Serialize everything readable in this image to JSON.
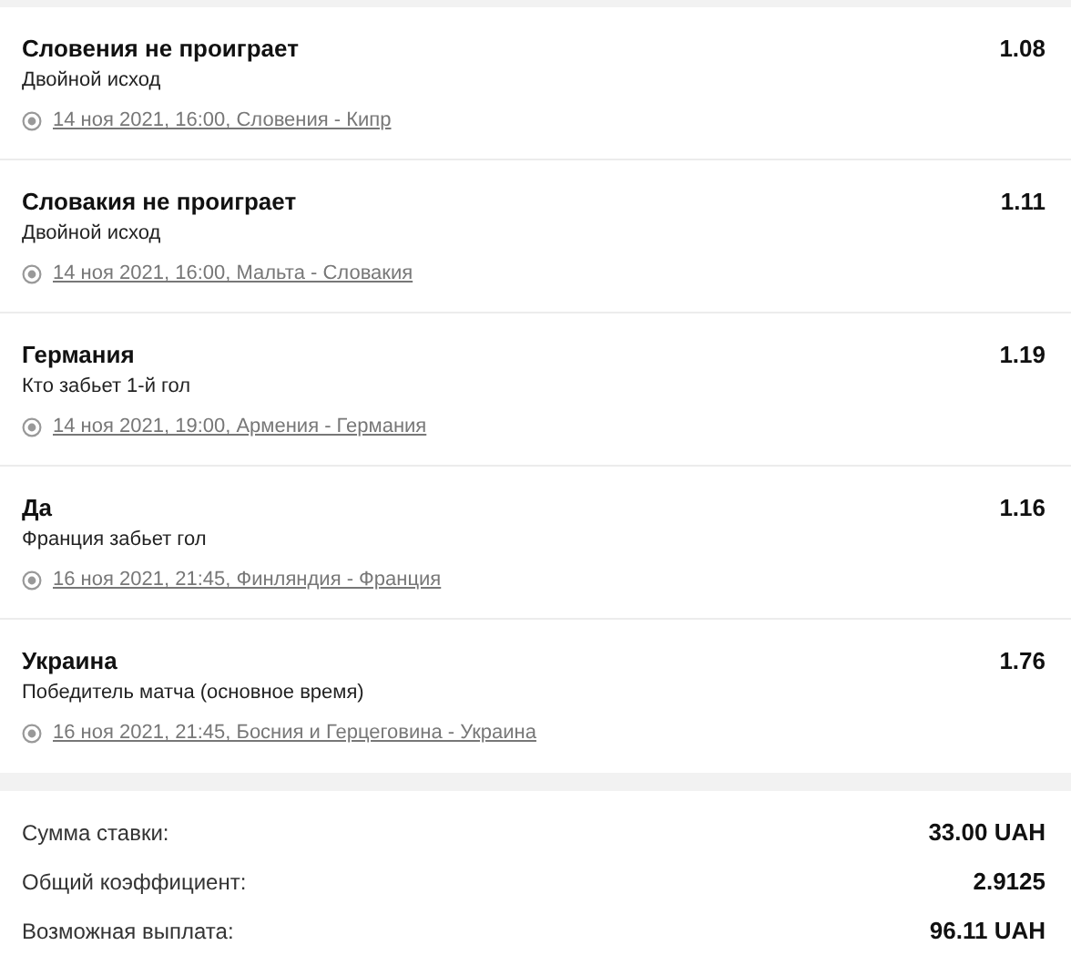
{
  "bets": [
    {
      "title": "Словения не проиграет",
      "market": "Двойной исход",
      "event": "14 ноя 2021, 16:00, Словения - Кипр",
      "odds": "1.08"
    },
    {
      "title": "Словакия не проиграет",
      "market": "Двойной исход",
      "event": "14 ноя 2021, 16:00, Мальта - Словакия",
      "odds": "1.11"
    },
    {
      "title": "Германия",
      "market": "Кто забьет 1-й гол",
      "event": "14 ноя 2021, 19:00, Армения - Германия",
      "odds": "1.19"
    },
    {
      "title": "Да",
      "market": "Франция забьет гол",
      "event": "16 ноя 2021, 21:45, Финляндия - Франция",
      "odds": "1.16"
    },
    {
      "title": "Украина",
      "market": "Победитель матча (основное время)",
      "event": "16 ноя 2021, 21:45, Босния и Герцеговина - Украина",
      "odds": "1.76"
    }
  ],
  "summary": [
    {
      "label": "Сумма ставки:",
      "value": "33.00 UAH"
    },
    {
      "label": "Общий коэффициент:",
      "value": "2.9125"
    },
    {
      "label": "Возможная выплата:",
      "value": "96.11 UAH"
    }
  ]
}
